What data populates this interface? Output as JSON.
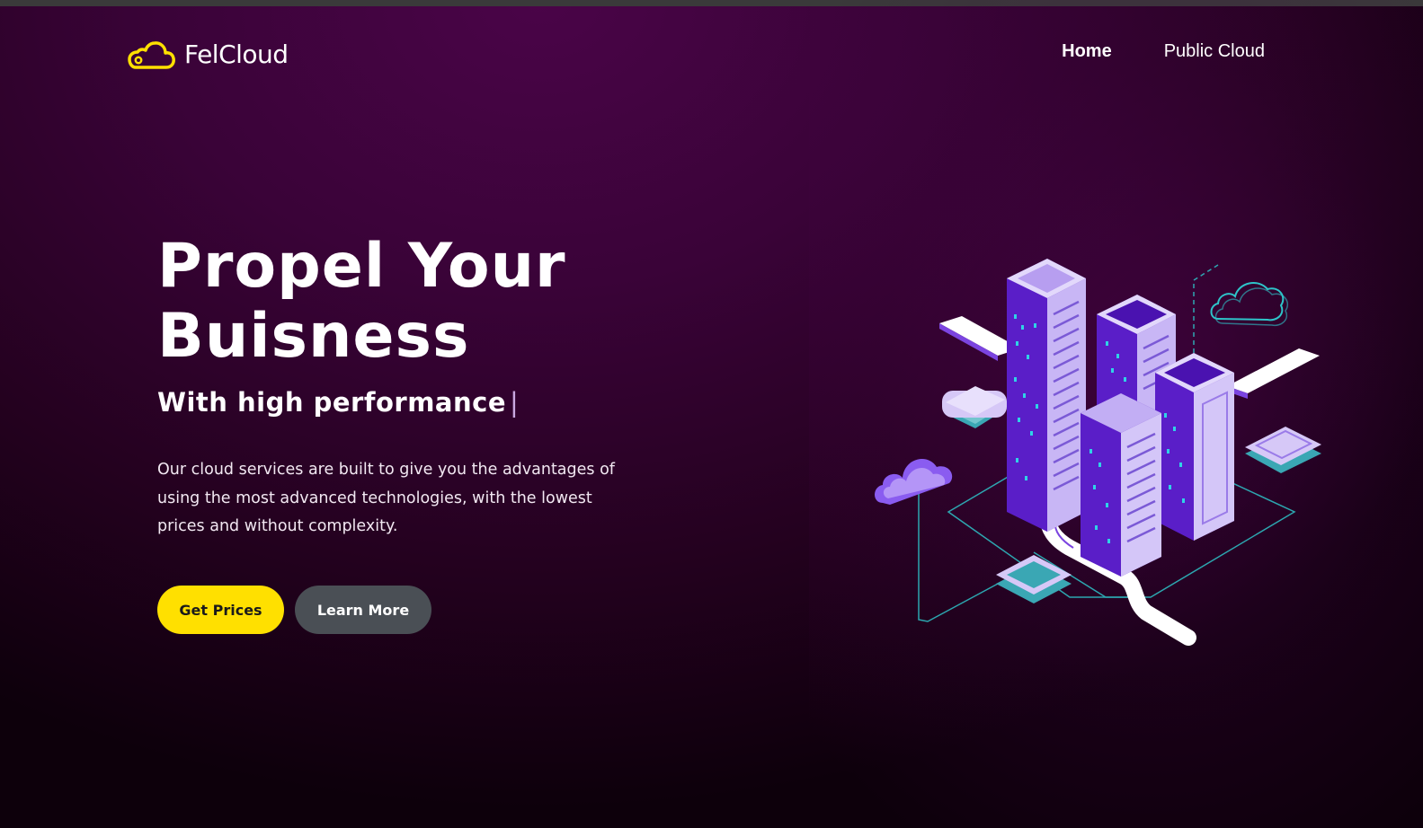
{
  "brand": {
    "name": "FelCloud",
    "logo_icon": "cloud-icon",
    "accent_color": "#ffe000"
  },
  "nav": {
    "items": [
      {
        "label": "Home",
        "active": true
      },
      {
        "label": "Public Cloud",
        "active": false
      }
    ]
  },
  "hero": {
    "title_line1": "Propel Your",
    "title_line2": "Buisness",
    "subtitle": "With high performance",
    "caret": "|",
    "description": "Our cloud services are built to give you the advantages of using the most advanced technologies, with the lowest prices and without complexity.",
    "primary_button": "Get Prices",
    "secondary_button": "Learn More",
    "illustration_icon": "isometric-city-illustration"
  },
  "colors": {
    "background": "#3a0338",
    "primary_button": "#ffe000",
    "secondary_button": "#4a4f55"
  }
}
